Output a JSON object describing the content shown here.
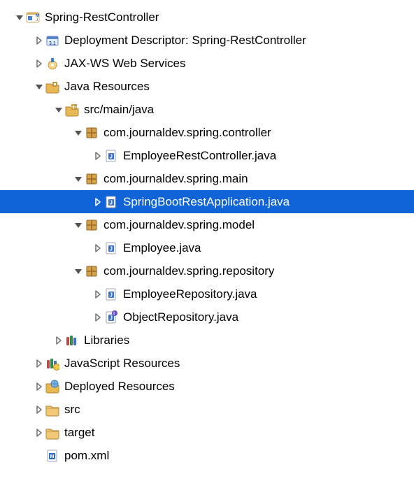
{
  "tree": [
    {
      "indent": 0,
      "arrow": "down",
      "icon": "project",
      "label": "Spring-RestController",
      "selected": false
    },
    {
      "indent": 1,
      "arrow": "right",
      "icon": "webxml",
      "label": "Deployment Descriptor: Spring-RestController",
      "selected": false
    },
    {
      "indent": 1,
      "arrow": "right",
      "icon": "jaxws",
      "label": "JAX-WS Web Services",
      "selected": false
    },
    {
      "indent": 1,
      "arrow": "down",
      "icon": "javares",
      "label": "Java Resources",
      "selected": false
    },
    {
      "indent": 2,
      "arrow": "down",
      "icon": "srcfolder",
      "label": "src/main/java",
      "selected": false
    },
    {
      "indent": 3,
      "arrow": "down",
      "icon": "package",
      "label": "com.journaldev.spring.controller",
      "selected": false
    },
    {
      "indent": 4,
      "arrow": "right",
      "icon": "javafile",
      "label": "EmployeeRestController.java",
      "selected": false
    },
    {
      "indent": 3,
      "arrow": "down",
      "icon": "package",
      "label": "com.journaldev.spring.main",
      "selected": false
    },
    {
      "indent": 4,
      "arrow": "right",
      "icon": "javafile",
      "label": "SpringBootRestApplication.java",
      "selected": true
    },
    {
      "indent": 3,
      "arrow": "down",
      "icon": "package",
      "label": "com.journaldev.spring.model",
      "selected": false
    },
    {
      "indent": 4,
      "arrow": "right",
      "icon": "javafile",
      "label": "Employee.java",
      "selected": false
    },
    {
      "indent": 3,
      "arrow": "down",
      "icon": "package",
      "label": "com.journaldev.spring.repository",
      "selected": false
    },
    {
      "indent": 4,
      "arrow": "right",
      "icon": "javafile",
      "label": "EmployeeRepository.java",
      "selected": false
    },
    {
      "indent": 4,
      "arrow": "right",
      "icon": "javaiface",
      "label": "ObjectRepository.java",
      "selected": false
    },
    {
      "indent": 2,
      "arrow": "right",
      "icon": "libraries",
      "label": "Libraries",
      "selected": false
    },
    {
      "indent": 1,
      "arrow": "right",
      "icon": "jslib",
      "label": "JavaScript Resources",
      "selected": false
    },
    {
      "indent": 1,
      "arrow": "right",
      "icon": "deployed",
      "label": "Deployed Resources",
      "selected": false
    },
    {
      "indent": 1,
      "arrow": "right",
      "icon": "folder",
      "label": "src",
      "selected": false
    },
    {
      "indent": 1,
      "arrow": "right",
      "icon": "folder",
      "label": "target",
      "selected": false
    },
    {
      "indent": 1,
      "arrow": "none",
      "icon": "pom",
      "label": "pom.xml",
      "selected": false
    }
  ]
}
